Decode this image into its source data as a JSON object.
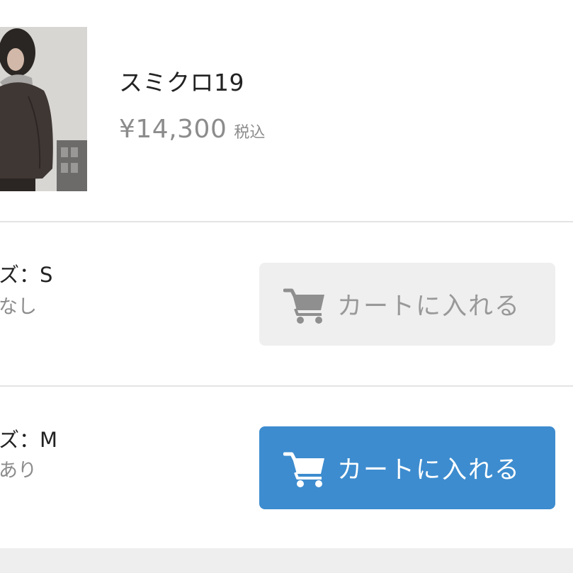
{
  "product": {
    "name": "スミクロ19",
    "price": "¥14,300",
    "tax_note": "税込"
  },
  "variants": [
    {
      "size_label": "ズ：S",
      "stock_label": "なし",
      "button_label": "カートに入れる",
      "button_state": "disabled"
    },
    {
      "size_label": "ズ：M",
      "stock_label": "あり",
      "button_label": "カートに入れる",
      "button_state": "enabled"
    }
  ],
  "colors": {
    "button_enabled": "#3d8ccf",
    "button_disabled": "#efefef",
    "price_text": "#8c8c8c"
  },
  "icons": {
    "cart": "cart-icon"
  }
}
